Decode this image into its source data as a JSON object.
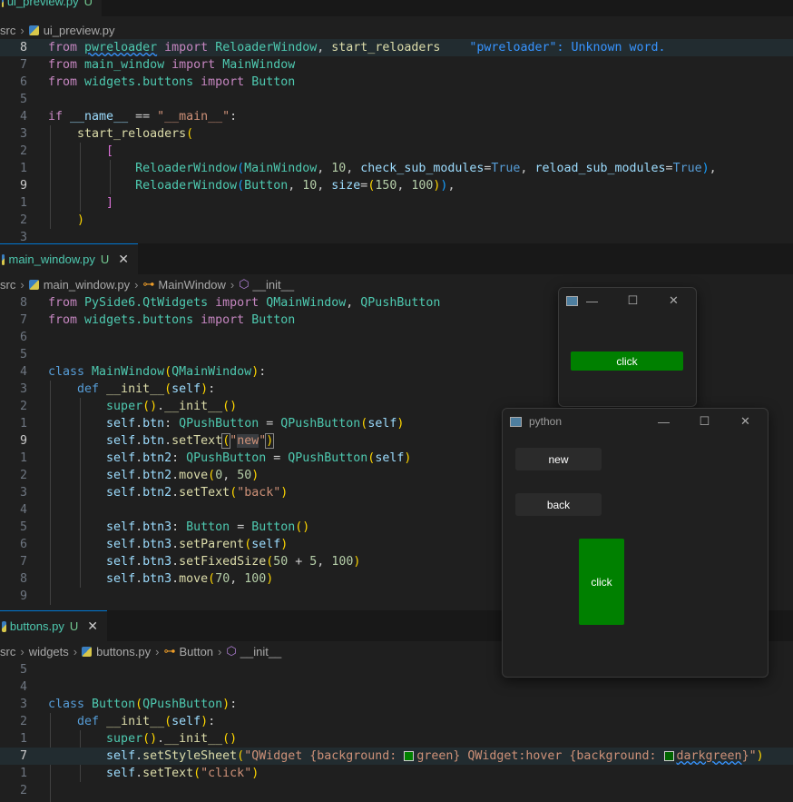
{
  "tabs": {
    "t1": {
      "name": "ui_preview.py",
      "flag": "U"
    },
    "t2": {
      "name": "main_window.py",
      "flag": "U",
      "close": "✕"
    },
    "t3": {
      "name": "buttons.py",
      "flag": "U",
      "close": "✕"
    }
  },
  "breadcrumbs": {
    "b1": {
      "src": "src",
      "file": "ui_preview.py"
    },
    "b2": {
      "src": "src",
      "file": "main_window.py",
      "cls": "MainWindow",
      "meth": "__init__"
    },
    "b3": {
      "src": "src",
      "folder": "widgets",
      "file": "buttons.py",
      "cls": "Button",
      "meth": "__init__"
    }
  },
  "diagnostic": "\"pwreloader\": Unknown word.",
  "colors": {
    "green_button": "#008000",
    "accent": "#0078d4"
  },
  "windows": {
    "w1": {
      "title": "",
      "button": "click"
    },
    "w2": {
      "title": "python",
      "btn_new": "new",
      "btn_back": "back",
      "btn_click": "click"
    },
    "controls": {
      "min": "—",
      "max": "☐",
      "close": "✕"
    }
  },
  "editor1_lines": [
    "8",
    "7",
    "6",
    "5",
    "4",
    "3",
    "2",
    "1",
    "9",
    "1",
    "2",
    "3"
  ],
  "editor2_lines": [
    "8",
    "7",
    "6",
    "5",
    "4",
    "3",
    "2",
    "1",
    "9",
    "1",
    "2",
    "3",
    "4",
    "5",
    "6",
    "7",
    "8",
    "9"
  ],
  "editor3_lines": [
    "5",
    "4",
    "3",
    "2",
    "1",
    "7",
    "1",
    "2"
  ]
}
